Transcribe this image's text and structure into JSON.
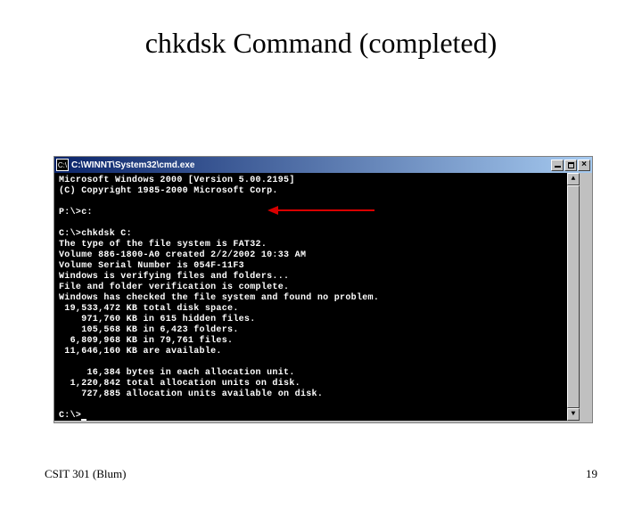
{
  "slide": {
    "title": "chkdsk Command (completed)",
    "footer_left": "CSIT 301 (Blum)",
    "page_num": "19"
  },
  "window": {
    "title": "C:\\WINNT\\System32\\cmd.exe",
    "icon_label": "C:\\"
  },
  "terminal": {
    "lines": [
      "Microsoft Windows 2000 [Version 5.00.2195]",
      "(C) Copyright 1985-2000 Microsoft Corp.",
      "",
      "P:\\>c:",
      "",
      "C:\\>chkdsk C:",
      "The type of the file system is FAT32.",
      "Volume 886-1800-A0 created 2/2/2002 10:33 AM",
      "Volume Serial Number is 054F-11F3",
      "Windows is verifying files and folders...",
      "File and folder verification is complete.",
      "Windows has checked the file system and found no problem.",
      " 19,533,472 KB total disk space.",
      "    971,760 KB in 615 hidden files.",
      "    105,568 KB in 6,423 folders.",
      "  6,809,968 KB in 79,761 files.",
      " 11,646,160 KB are available.",
      "",
      "     16,384 bytes in each allocation unit.",
      "  1,220,842 total allocation units on disk.",
      "    727,885 allocation units available on disk.",
      "",
      "C:\\>"
    ]
  }
}
